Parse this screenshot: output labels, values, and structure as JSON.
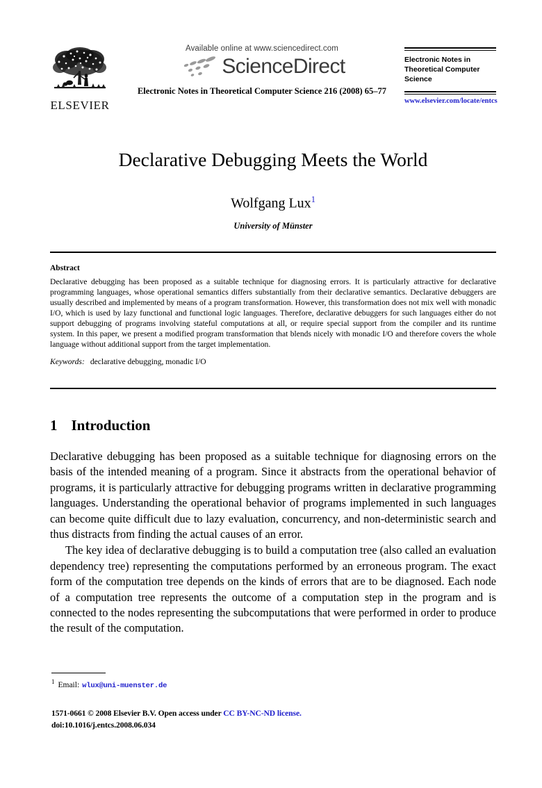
{
  "header": {
    "publisher_logo_text": "ELSEVIER",
    "available_online": "Available online at www.sciencedirect.com",
    "sciencedirect_wordmark": "ScienceDirect",
    "journal_reference": "Electronic Notes in Theoretical Computer Science 216 (2008) 65–77",
    "masthead_title": "Electronic Notes in Theoretical Computer Science",
    "masthead_url": "www.elsevier.com/locate/entcs"
  },
  "article": {
    "title": "Declarative Debugging Meets the World",
    "author": "Wolfgang Lux",
    "author_footnote_marker": "1",
    "affiliation": "University of Münster"
  },
  "abstract": {
    "heading": "Abstract",
    "text": "Declarative debugging has been proposed as a suitable technique for diagnosing errors. It is particularly attractive for declarative programming languages, whose operational semantics differs substantially from their declarative semantics. Declarative debuggers are usually described and implemented by means of a program transformation. However, this transformation does not mix well with monadic I/O, which is used by lazy functional and functional logic languages. Therefore, declarative debuggers for such languages either do not support debugging of programs involving stateful computations at all, or require special support from the compiler and its runtime system. In this paper, we present a modified program transformation that blends nicely with monadic I/O and therefore covers the whole language without additional support from the target implementation.",
    "keywords_label": "Keywords:",
    "keywords_value": "declarative debugging, monadic I/O"
  },
  "section": {
    "number": "1",
    "title": "Introduction",
    "paragraphs": [
      "Declarative debugging has been proposed as a suitable technique for diagnosing errors on the basis of the intended meaning of a program. Since it abstracts from the operational behavior of programs, it is particularly attractive for debugging programs written in declarative programming languages. Understanding the operational behavior of programs implemented in such languages can become quite difficult due to lazy evaluation, concurrency, and non-deterministic search and thus distracts from finding the actual causes of an error.",
      "The key idea of declarative debugging is to build a computation tree (also called an evaluation dependency tree) representing the computations performed by an erroneous program. The exact form of the computation tree depends on the kinds of errors that are to be diagnosed. Each node of a computation tree represents the outcome of a computation step in the program and is connected to the nodes representing the subcomputations that were performed in order to produce the result of the computation."
    ]
  },
  "footnote": {
    "marker": "1",
    "label": "Email:",
    "email": "wlux@uni-muenster.de"
  },
  "footer": {
    "copyright_prefix": "1571-0661 © 2008 Elsevier B.V. Open access under ",
    "license_link": "CC BY-NC-ND license.",
    "doi": "doi:10.1016/j.entcs.2008.06.034"
  },
  "colors": {
    "link_blue": "#2222cc",
    "sciencedirect_gray": "#3b3b3b",
    "text_black": "#000000"
  }
}
